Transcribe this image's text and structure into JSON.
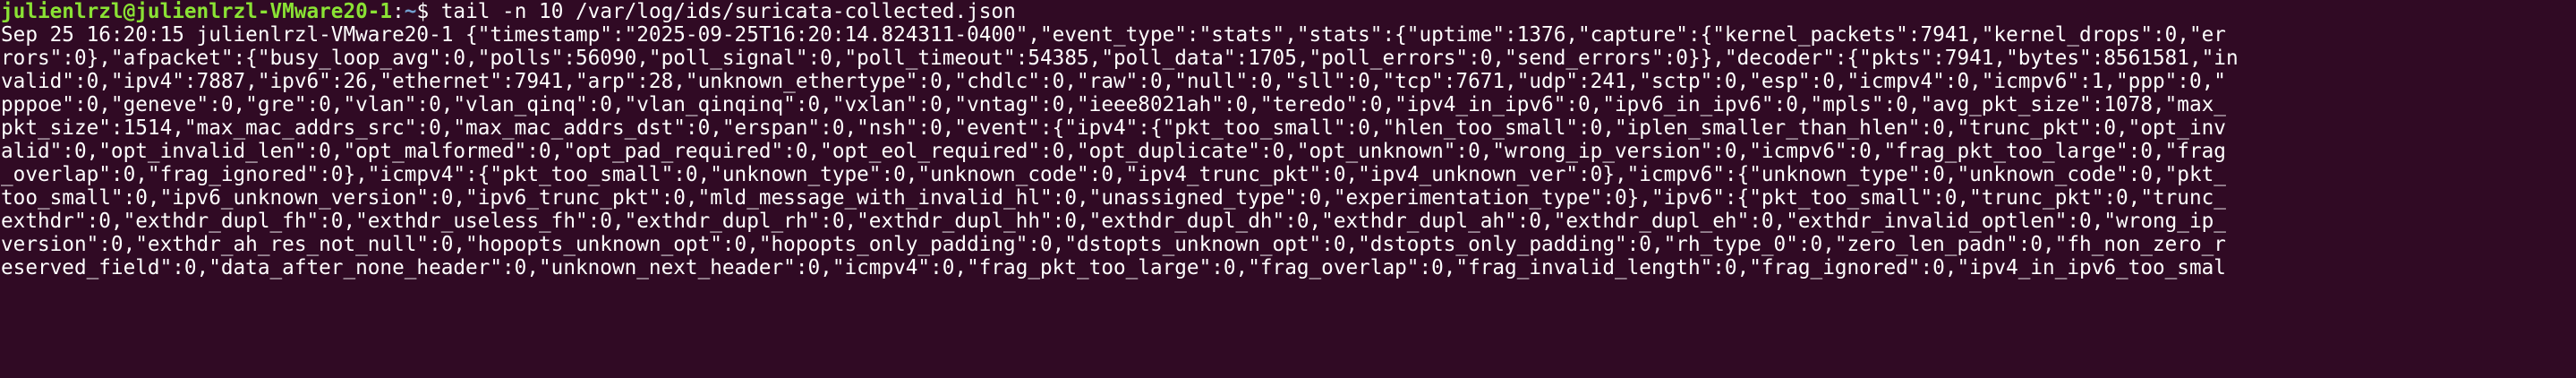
{
  "terminal": {
    "prompt": {
      "user_host": "julienlrzl@julienlrzl-VMware20-1",
      "separator": ":",
      "path": "~",
      "symbol": "$ "
    },
    "command": "tail -n 10 /var/log/ids/suricata-collected.json",
    "output_lines": [
      "Sep 25 16:20:15 julienlrzl-VMware20-1 {\"timestamp\":\"2025-09-25T16:20:14.824311-0400\",\"event_type\":\"stats\",\"stats\":{\"uptime\":1376,\"capture\":{\"kernel_packets\":7941,\"kernel_drops\":0,\"er",
      "rors\":0},\"afpacket\":{\"busy_loop_avg\":0,\"polls\":56090,\"poll_signal\":0,\"poll_timeout\":54385,\"poll_data\":1705,\"poll_errors\":0,\"send_errors\":0}},\"decoder\":{\"pkts\":7941,\"bytes\":8561581,\"in",
      "valid\":0,\"ipv4\":7887,\"ipv6\":26,\"ethernet\":7941,\"arp\":28,\"unknown_ethertype\":0,\"chdlc\":0,\"raw\":0,\"null\":0,\"sll\":0,\"tcp\":7671,\"udp\":241,\"sctp\":0,\"esp\":0,\"icmpv4\":0,\"icmpv6\":1,\"ppp\":0,\"",
      "pppoe\":0,\"geneve\":0,\"gre\":0,\"vlan\":0,\"vlan_qinq\":0,\"vlan_qinqinq\":0,\"vxlan\":0,\"vntag\":0,\"ieee8021ah\":0,\"teredo\":0,\"ipv4_in_ipv6\":0,\"ipv6_in_ipv6\":0,\"mpls\":0,\"avg_pkt_size\":1078,\"max_",
      "pkt_size\":1514,\"max_mac_addrs_src\":0,\"max_mac_addrs_dst\":0,\"erspan\":0,\"nsh\":0,\"event\":{\"ipv4\":{\"pkt_too_small\":0,\"hlen_too_small\":0,\"iplen_smaller_than_hlen\":0,\"trunc_pkt\":0,\"opt_inv",
      "alid\":0,\"opt_invalid_len\":0,\"opt_malformed\":0,\"opt_pad_required\":0,\"opt_eol_required\":0,\"opt_duplicate\":0,\"opt_unknown\":0,\"wrong_ip_version\":0,\"icmpv6\":0,\"frag_pkt_too_large\":0,\"frag",
      "_overlap\":0,\"frag_ignored\":0},\"icmpv4\":{\"pkt_too_small\":0,\"unknown_type\":0,\"unknown_code\":0,\"ipv4_trunc_pkt\":0,\"ipv4_unknown_ver\":0},\"icmpv6\":{\"unknown_type\":0,\"unknown_code\":0,\"pkt_",
      "too_small\":0,\"ipv6_unknown_version\":0,\"ipv6_trunc_pkt\":0,\"mld_message_with_invalid_hl\":0,\"unassigned_type\":0,\"experimentation_type\":0},\"ipv6\":{\"pkt_too_small\":0,\"trunc_pkt\":0,\"trunc_",
      "exthdr\":0,\"exthdr_dupl_fh\":0,\"exthdr_useless_fh\":0,\"exthdr_dupl_rh\":0,\"exthdr_dupl_hh\":0,\"exthdr_dupl_dh\":0,\"exthdr_dupl_ah\":0,\"exthdr_dupl_eh\":0,\"exthdr_invalid_optlen\":0,\"wrong_ip_",
      "version\":0,\"exthdr_ah_res_not_null\":0,\"hopopts_unknown_opt\":0,\"hopopts_only_padding\":0,\"dstopts_unknown_opt\":0,\"dstopts_only_padding\":0,\"rh_type_0\":0,\"zero_len_padn\":0,\"fh_non_zero_r",
      "eserved_field\":0,\"data_after_none_header\":0,\"unknown_next_header\":0,\"icmpv4\":0,\"frag_pkt_too_large\":0,\"frag_overlap\":0,\"frag_invalid_length\":0,\"frag_ignored\":0,\"ipv4_in_ipv6_too_smal"
    ]
  }
}
